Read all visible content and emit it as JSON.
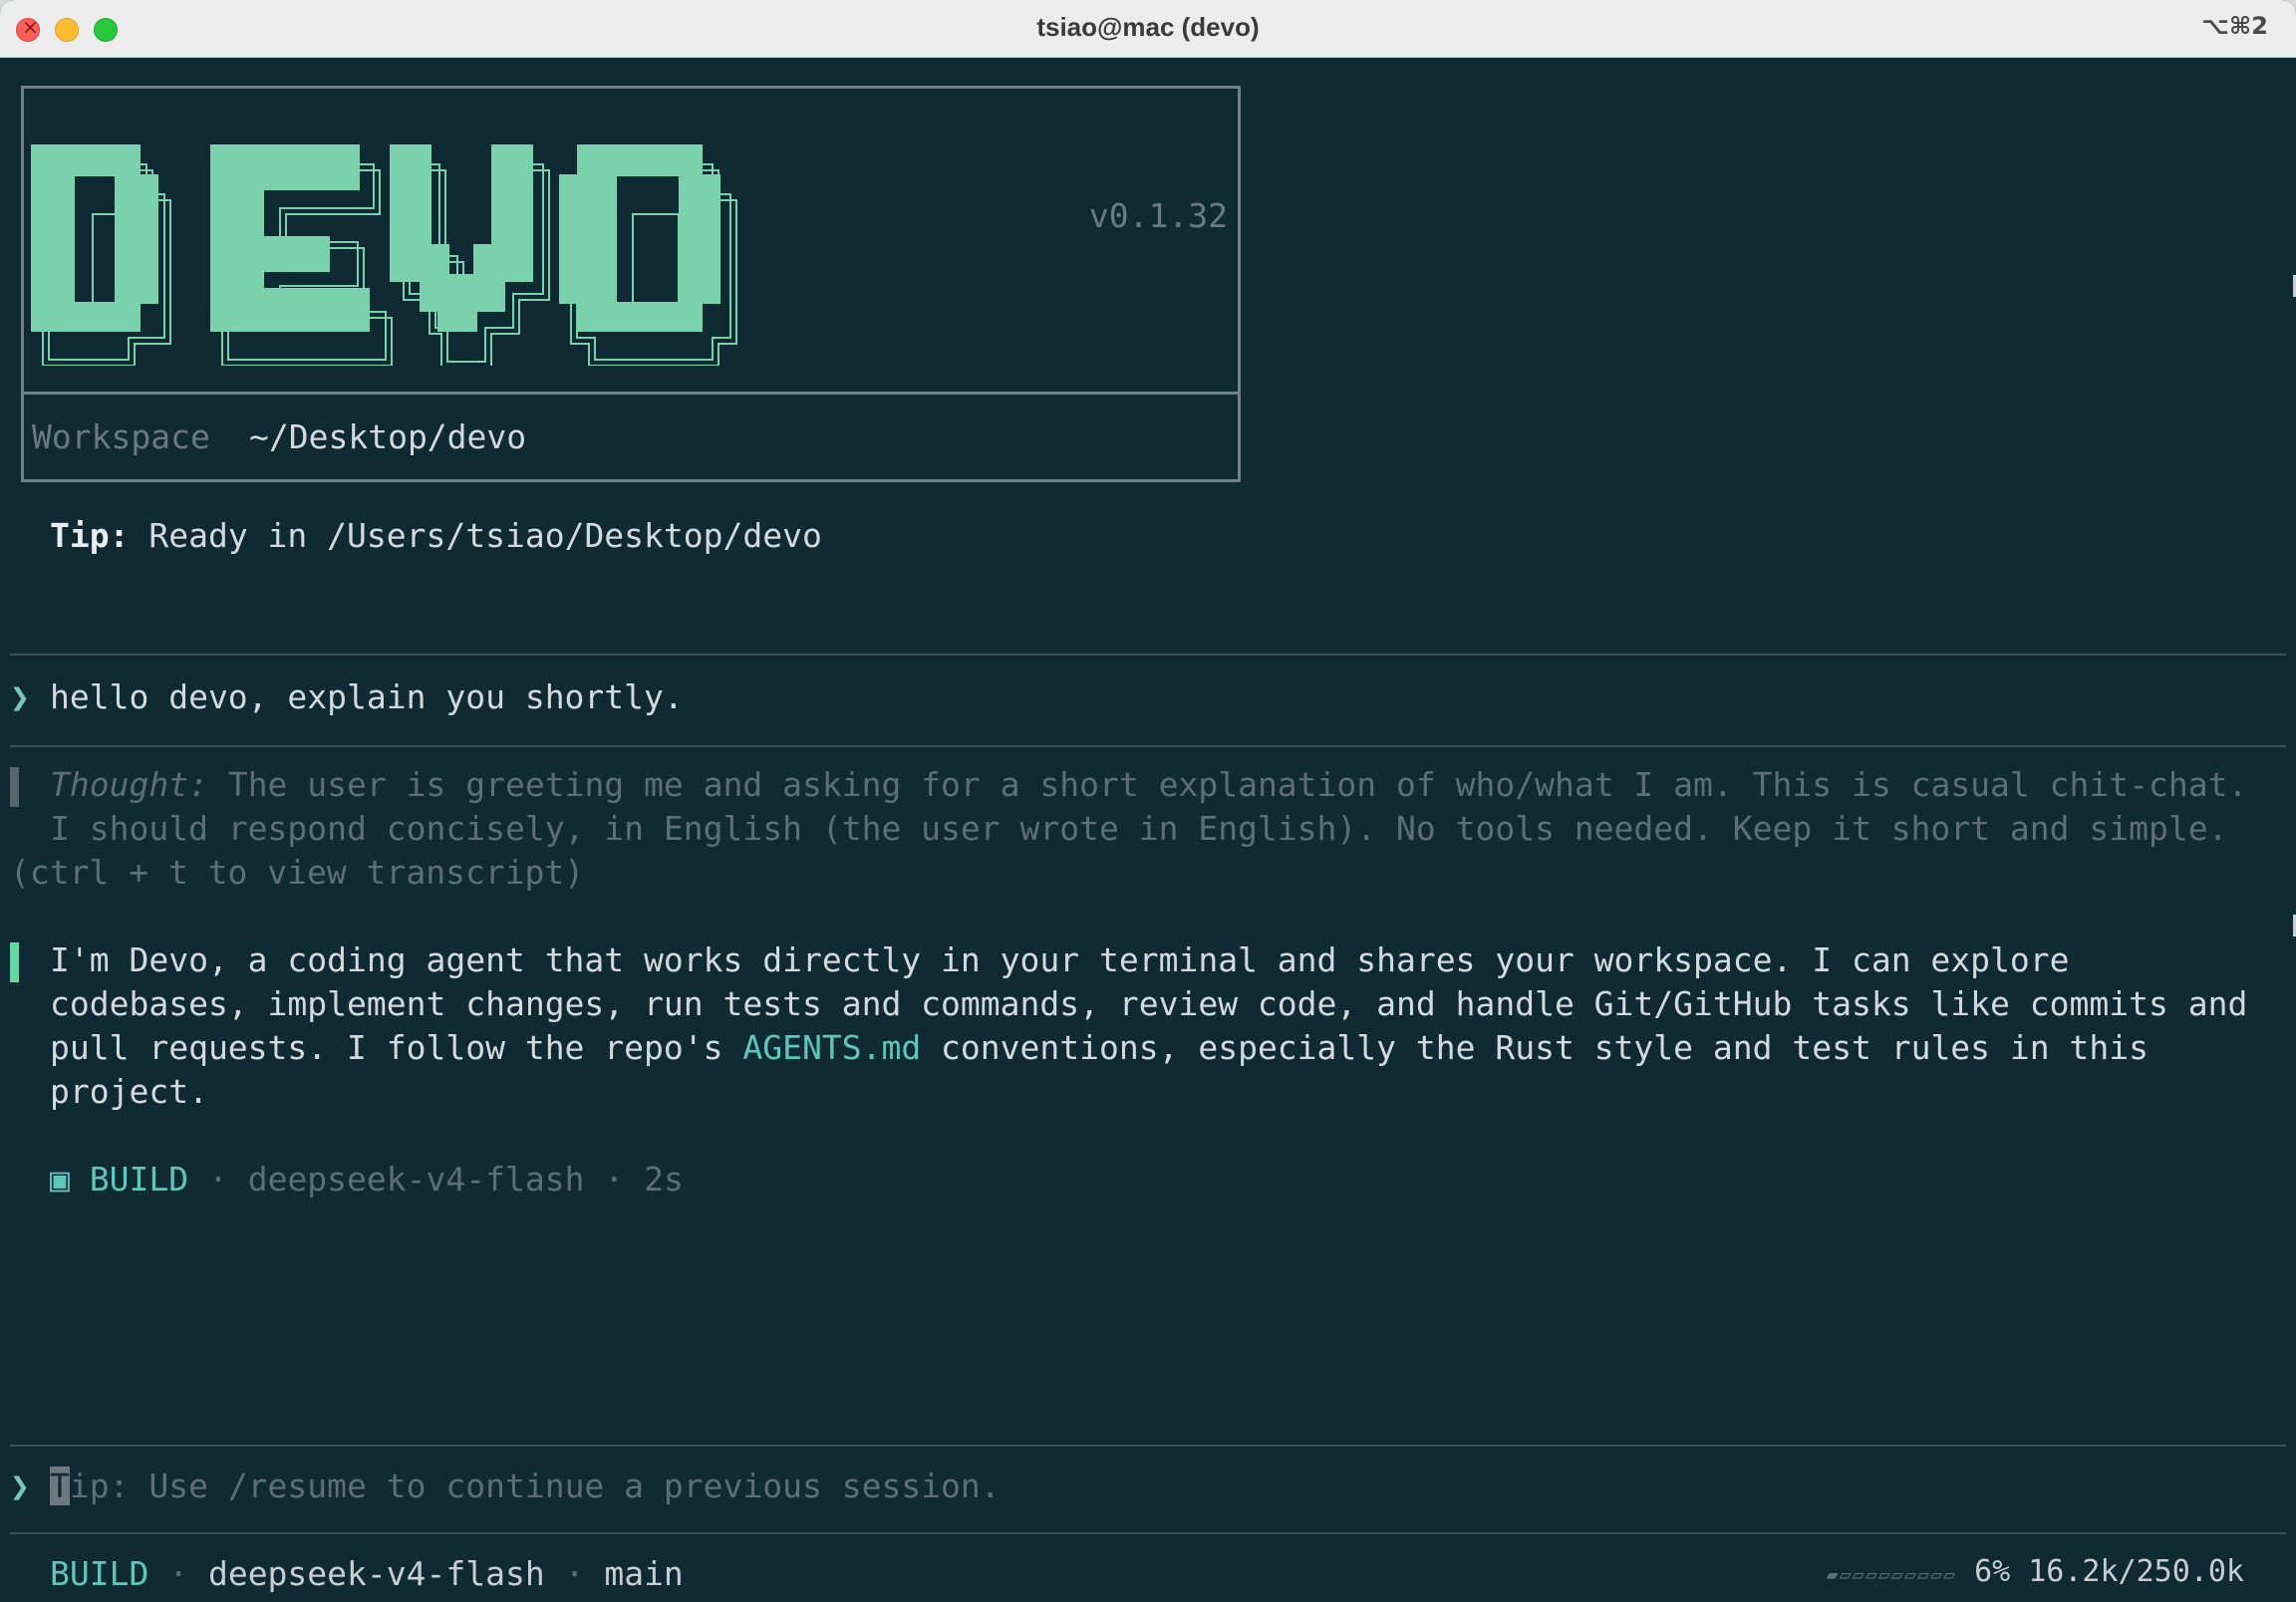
{
  "window": {
    "title": "tsiao@mac (devo)",
    "shortcut": "⌥⌘2"
  },
  "banner": {
    "logo_text": "DEVO",
    "version": "v0.1.32",
    "workspace_label": "Workspace",
    "workspace_path": "~/Desktop/devo"
  },
  "tip": {
    "label": "Tip:",
    "text": " Ready in /Users/tsiao/Desktop/devo"
  },
  "user_message": {
    "chevron": "❯",
    "text": "hello devo, explain you shortly."
  },
  "thought": {
    "label": "Thought:",
    "line1": " The user is greeting me and asking for a short explanation of who/what I am. This is casual chit-chat.",
    "line2": "I should respond concisely, in English (the user wrote in English). No tools needed. Keep it short and simple.",
    "hint": "(ctrl + t to view transcript)"
  },
  "response": {
    "line1": "I'm Devo, a coding agent that works directly in your terminal and shares your workspace. I can explore",
    "line2": "codebases, implement changes, run tests and commands, review code, and handle Git/GitHub tasks like commits and",
    "line3_pre": "pull requests. I follow the repo's ",
    "line3_link": "AGENTS.md",
    "line3_post": " conventions, especially the Rust style and test rules in this",
    "line4": "project."
  },
  "build_meta": {
    "icon": "▣",
    "mode": "BUILD",
    "sep": " · ",
    "model": "deepseek-v4-flash",
    "duration": "2s"
  },
  "input": {
    "chevron": "❯",
    "cursor_char": "T",
    "placeholder_rest": "ip: Use /resume to continue a previous session."
  },
  "status": {
    "mode": "BUILD",
    "sep": " · ",
    "model": "deepseek-v4-flash",
    "branch": "main",
    "context_bar": "▰▱▱▱▱▱▱▱▱▱",
    "context_percent": "6%",
    "context_tokens": "16.2k/250.0k"
  },
  "colors": {
    "background": "#0f2a33",
    "logo": "#79d2ac",
    "accent": "#5ec7bd",
    "response_bar": "#66d8a7",
    "dim_text": "#5d6e76"
  }
}
